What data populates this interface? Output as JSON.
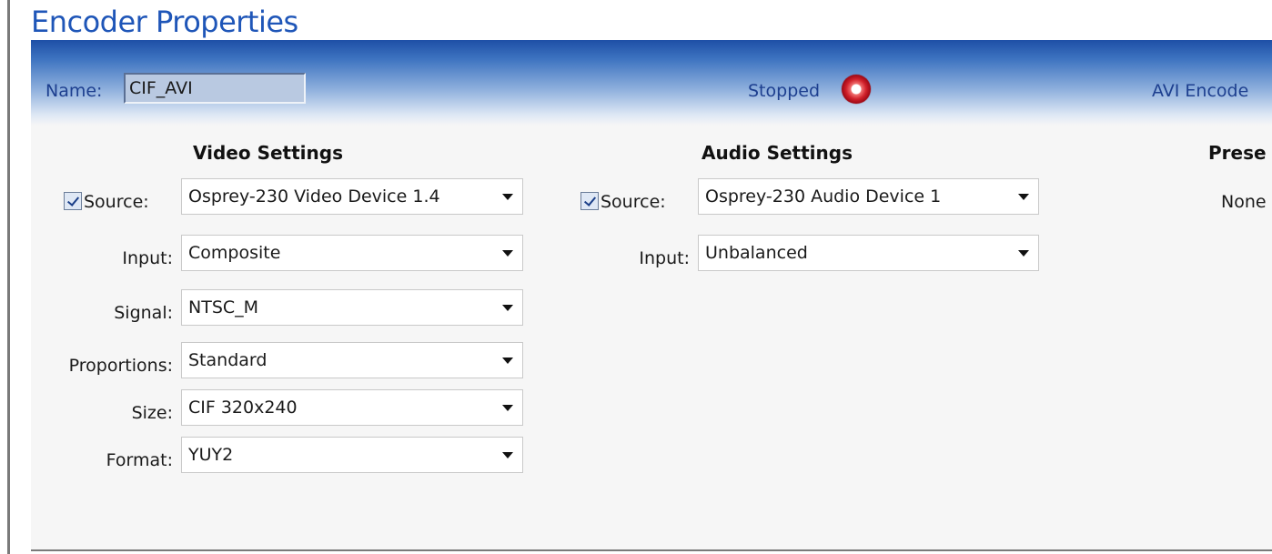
{
  "title": "Encoder Properties",
  "header": {
    "name_label": "Name:",
    "name_value": "CIF_AVI",
    "status": "Stopped",
    "status_color": "#d0202a",
    "encoder_type": "AVI Encode"
  },
  "video": {
    "title": "Video Settings",
    "source_checked": true,
    "rows": [
      {
        "label": "Source:",
        "value": "Osprey-230 Video Device 1.4"
      },
      {
        "label": "Input:",
        "value": "Composite"
      },
      {
        "label": "Signal:",
        "value": "NTSC_M"
      },
      {
        "label": "Proportions:",
        "value": "Standard"
      },
      {
        "label": "Size:",
        "value": "CIF 320x240"
      },
      {
        "label": "Format:",
        "value": "YUY2"
      }
    ]
  },
  "audio": {
    "title": "Audio Settings",
    "source_checked": true,
    "rows": [
      {
        "label": "Source:",
        "value": "Osprey-230 Audio Device 1"
      },
      {
        "label": "Input:",
        "value": "Unbalanced"
      }
    ]
  },
  "presets": {
    "title": "Prese",
    "value": "None"
  },
  "colors": {
    "accent": "#1f56b8",
    "header_gradient_top": "#1e4fa6"
  }
}
